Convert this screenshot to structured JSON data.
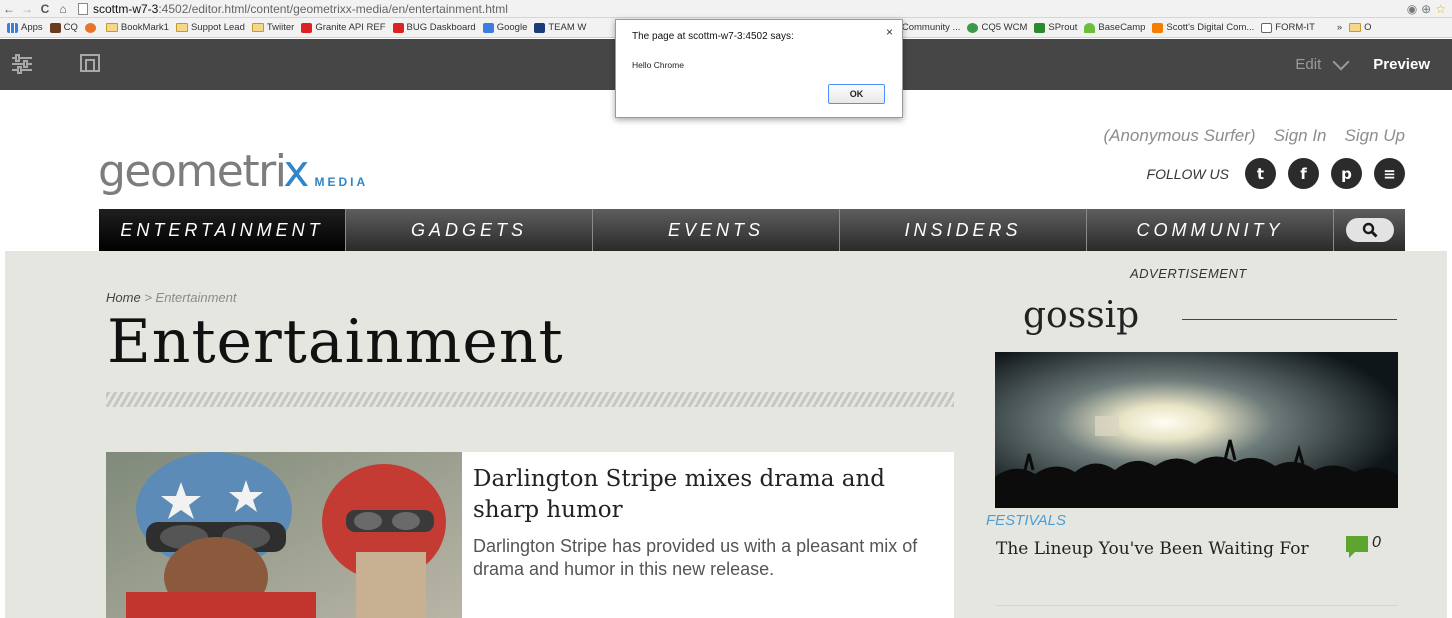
{
  "browser": {
    "url_host": "scottm-w7-3",
    "url_path": ":4502/editor.html/content/geometrixx-media/en/entertainment.html",
    "nav_icons": [
      "back-icon",
      "forward-icon",
      "reload-icon",
      "home-icon"
    ]
  },
  "bookmarks": [
    {
      "label": "Apps",
      "icon": "apps-grid-icon"
    },
    {
      "label": "CQ",
      "icon": "cq-icon"
    },
    {
      "label": "",
      "icon": "bookmark-icon"
    },
    {
      "label": "BookMark1",
      "icon": "folder-icon"
    },
    {
      "label": "Suppot Lead",
      "icon": "folder-icon"
    },
    {
      "label": "Twiiter",
      "icon": "folder-icon"
    },
    {
      "label": "Granite API REF",
      "icon": "adobe-icon"
    },
    {
      "label": "BUG Daskboard",
      "icon": "adobe-icon"
    },
    {
      "label": "Google",
      "icon": "google-icon"
    },
    {
      "label": "TEAM W",
      "icon": "team-icon"
    },
    {
      "label": "obe Community ...",
      "icon": ""
    },
    {
      "label": "CQ5 WCM",
      "icon": "globe-icon"
    },
    {
      "label": "SProut",
      "icon": "sprout-icon"
    },
    {
      "label": "BaseCamp",
      "icon": "basecamp-icon"
    },
    {
      "label": "Scott's Digital Com...",
      "icon": "blogger-icon"
    },
    {
      "label": "FORM-IT",
      "icon": "form-icon"
    },
    {
      "label": "»",
      "icon": ""
    },
    {
      "label": "O",
      "icon": "folder-icon"
    }
  ],
  "editor": {
    "mode_label": "Edit",
    "preview_label": "Preview"
  },
  "header": {
    "logo_text": "geometri",
    "logo_x": "x",
    "logo_media": "MEDIA",
    "anonymous": "(Anonymous Surfer)",
    "sign_in": "Sign In",
    "sign_up": "Sign Up",
    "follow_label": "FOLLOW US",
    "social": [
      {
        "icon": "twitter-icon",
        "glyph": "t"
      },
      {
        "icon": "facebook-icon",
        "glyph": "f"
      },
      {
        "icon": "pinterest-icon",
        "glyph": "p"
      },
      {
        "icon": "rss-icon",
        "glyph": "≡"
      }
    ]
  },
  "nav": {
    "items": [
      "ENTERTAINMENT",
      "GADGETS",
      "EVENTS",
      "INSIDERS",
      "COMMUNITY"
    ],
    "active_index": 0
  },
  "breadcrumb": {
    "home": "Home",
    "separator": ">",
    "current": "Entertainment"
  },
  "page_title": "Entertainment",
  "article": {
    "title": "Darlington Stripe mixes drama and sharp humor",
    "summary": "Darlington Stripe has provided us with a pleasant mix of drama and humor in this new release."
  },
  "sidebar": {
    "ad_label": "ADVERTISEMENT",
    "section_title": "gossip",
    "tag": "FESTIVALS",
    "link": "The Lineup You've Been Waiting For",
    "comment_count": "0"
  },
  "alert": {
    "title": "The page at scottm-w7-3:4502 says:",
    "message": "Hello Chrome",
    "ok_label": "OK",
    "close_glyph": "×"
  },
  "colors": {
    "editor_bar": "#464646",
    "nav_dark": "#2a2a2a",
    "content_bg": "#e6e6e1",
    "accent_blue": "#2e86c8",
    "tag_blue": "#4a9fd8",
    "comment_green": "#5ea52f"
  }
}
